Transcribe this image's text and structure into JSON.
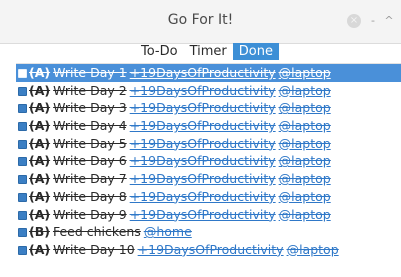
{
  "window": {
    "title": "Go For It!",
    "controls": {
      "close": "×",
      "minimize": "-",
      "maximize": "^"
    }
  },
  "tabs": [
    {
      "label": "To-Do",
      "active": false
    },
    {
      "label": "Timer",
      "active": false
    },
    {
      "label": "Done",
      "active": true
    }
  ],
  "colors": {
    "accent": "#3d8fd6",
    "selected_row": "#4a90d9",
    "tag": "#2f78c8"
  },
  "done_list": [
    {
      "priority": "(A)",
      "text": "Write Day 1",
      "tags": [
        "+19DaysOfProductivity",
        "@laptop"
      ],
      "checked": true,
      "selected": true
    },
    {
      "priority": "(A)",
      "text": "Write Day 2",
      "tags": [
        "+19DaysOfProductivity",
        "@laptop"
      ],
      "checked": true,
      "selected": false
    },
    {
      "priority": "(A)",
      "text": "Write Day 3",
      "tags": [
        "+19DaysOfProductivity",
        "@laptop"
      ],
      "checked": true,
      "selected": false
    },
    {
      "priority": "(A)",
      "text": "Write Day 4",
      "tags": [
        "+19DaysOfProductivity",
        "@laptop"
      ],
      "checked": true,
      "selected": false
    },
    {
      "priority": "(A)",
      "text": "Write Day 5",
      "tags": [
        "+19DaysOfProductivity",
        "@laptop"
      ],
      "checked": true,
      "selected": false
    },
    {
      "priority": "(A)",
      "text": "Write Day 6",
      "tags": [
        "+19DaysOfProductivity",
        "@laptop"
      ],
      "checked": true,
      "selected": false
    },
    {
      "priority": "(A)",
      "text": "Write Day 7",
      "tags": [
        "+19DaysOfProductivity",
        "@laptop"
      ],
      "checked": true,
      "selected": false
    },
    {
      "priority": "(A)",
      "text": "Write Day 8",
      "tags": [
        "+19DaysOfProductivity",
        "@laptop"
      ],
      "checked": true,
      "selected": false
    },
    {
      "priority": "(A)",
      "text": "Write Day 9",
      "tags": [
        "+19DaysOfProductivity",
        "@laptop"
      ],
      "checked": true,
      "selected": false
    },
    {
      "priority": "(B)",
      "text": "Feed chickens",
      "tags": [
        "@home"
      ],
      "checked": true,
      "selected": false
    },
    {
      "priority": "(A)",
      "text": "Write Day 10",
      "tags": [
        "+19DaysOfProductivity",
        "@laptop"
      ],
      "checked": true,
      "selected": false
    }
  ]
}
